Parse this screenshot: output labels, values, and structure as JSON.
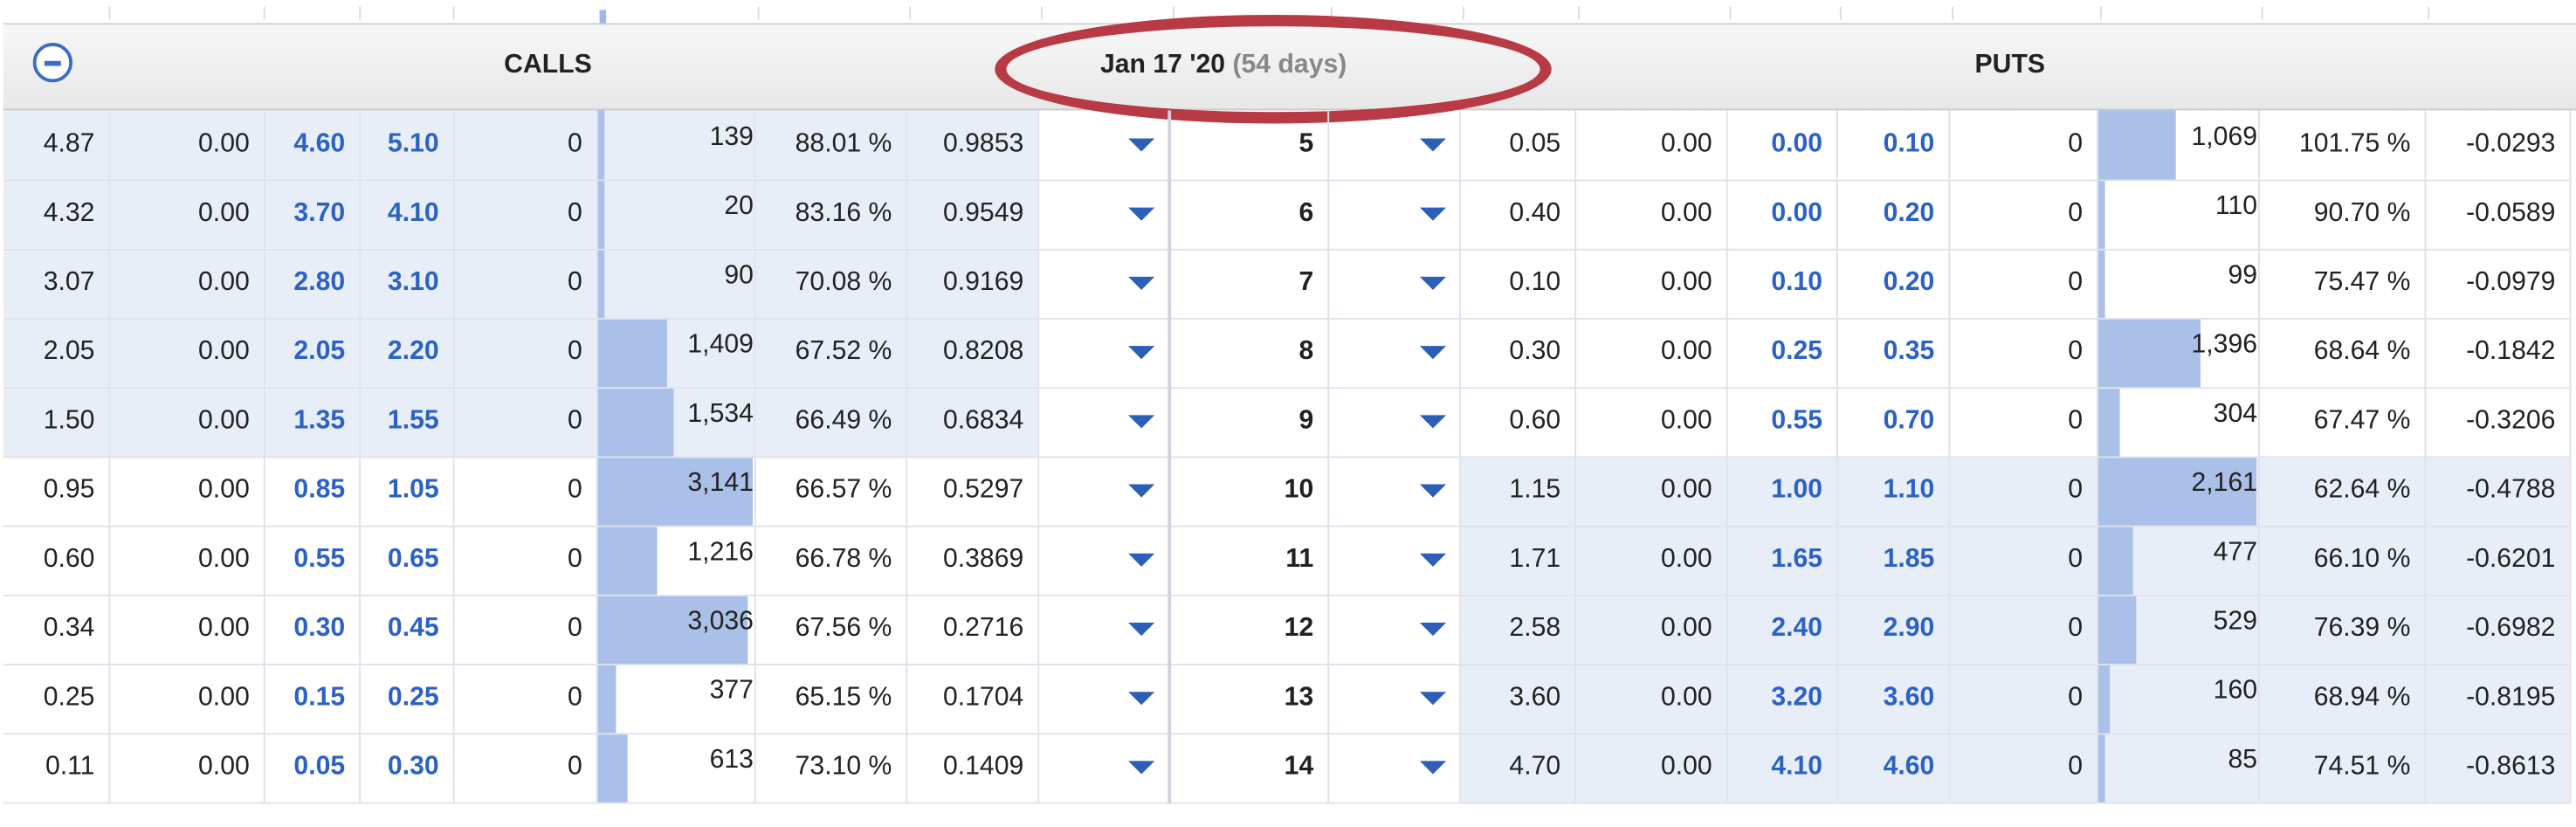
{
  "header": {
    "calls_label": "CALLS",
    "puts_label": "PUTS",
    "expiry": "Jan 17 '20",
    "days": "(54 days)",
    "collapse_icon": "minus-circle-icon"
  },
  "colors": {
    "itm_background": "#e8eef8",
    "bid_ask_text": "#2c62c4",
    "oi_bar": "#aac0e8",
    "highlight_ellipse": "#b83a45",
    "arrow": "#2c5fb8"
  },
  "rows": [
    {
      "call_last": "4.87",
      "call_change": "0.00",
      "call_bid": "4.60",
      "call_ask": "5.10",
      "call_volume": "0",
      "call_oi": "139",
      "call_oi_value": 139,
      "call_iv": "88.01 %",
      "call_delta": "0.9853",
      "strike": "5",
      "put_last": "0.05",
      "put_change": "0.00",
      "put_bid": "0.00",
      "put_ask": "0.10",
      "put_volume": "0",
      "put_oi": "1,069",
      "put_oi_value": 1069,
      "put_iv": "101.75 %",
      "put_delta": "-0.0293",
      "call_itm": true,
      "put_itm": false
    },
    {
      "call_last": "4.32",
      "call_change": "0.00",
      "call_bid": "3.70",
      "call_ask": "4.10",
      "call_volume": "0",
      "call_oi": "20",
      "call_oi_value": 20,
      "call_iv": "83.16 %",
      "call_delta": "0.9549",
      "strike": "6",
      "put_last": "0.40",
      "put_change": "0.00",
      "put_bid": "0.00",
      "put_ask": "0.20",
      "put_volume": "0",
      "put_oi": "110",
      "put_oi_value": 110,
      "put_iv": "90.70 %",
      "put_delta": "-0.0589",
      "call_itm": true,
      "put_itm": false
    },
    {
      "call_last": "3.07",
      "call_change": "0.00",
      "call_bid": "2.80",
      "call_ask": "3.10",
      "call_volume": "0",
      "call_oi": "90",
      "call_oi_value": 90,
      "call_iv": "70.08 %",
      "call_delta": "0.9169",
      "strike": "7",
      "put_last": "0.10",
      "put_change": "0.00",
      "put_bid": "0.10",
      "put_ask": "0.20",
      "put_volume": "0",
      "put_oi": "99",
      "put_oi_value": 99,
      "put_iv": "75.47 %",
      "put_delta": "-0.0979",
      "call_itm": true,
      "put_itm": false
    },
    {
      "call_last": "2.05",
      "call_change": "0.00",
      "call_bid": "2.05",
      "call_ask": "2.20",
      "call_volume": "0",
      "call_oi": "1,409",
      "call_oi_value": 1409,
      "call_iv": "67.52 %",
      "call_delta": "0.8208",
      "strike": "8",
      "put_last": "0.30",
      "put_change": "0.00",
      "put_bid": "0.25",
      "put_ask": "0.35",
      "put_volume": "0",
      "put_oi": "1,396",
      "put_oi_value": 1396,
      "put_iv": "68.64 %",
      "put_delta": "-0.1842",
      "call_itm": true,
      "put_itm": false
    },
    {
      "call_last": "1.50",
      "call_change": "0.00",
      "call_bid": "1.35",
      "call_ask": "1.55",
      "call_volume": "0",
      "call_oi": "1,534",
      "call_oi_value": 1534,
      "call_iv": "66.49 %",
      "call_delta": "0.6834",
      "strike": "9",
      "put_last": "0.60",
      "put_change": "0.00",
      "put_bid": "0.55",
      "put_ask": "0.70",
      "put_volume": "0",
      "put_oi": "304",
      "put_oi_value": 304,
      "put_iv": "67.47 %",
      "put_delta": "-0.3206",
      "call_itm": true,
      "put_itm": false
    },
    {
      "call_last": "0.95",
      "call_change": "0.00",
      "call_bid": "0.85",
      "call_ask": "1.05",
      "call_volume": "0",
      "call_oi": "3,141",
      "call_oi_value": 3141,
      "call_iv": "66.57 %",
      "call_delta": "0.5297",
      "strike": "10",
      "put_last": "1.15",
      "put_change": "0.00",
      "put_bid": "1.00",
      "put_ask": "1.10",
      "put_volume": "0",
      "put_oi": "2,161",
      "put_oi_value": 2161,
      "put_iv": "62.64 %",
      "put_delta": "-0.4788",
      "call_itm": false,
      "put_itm": true
    },
    {
      "call_last": "0.60",
      "call_change": "0.00",
      "call_bid": "0.55",
      "call_ask": "0.65",
      "call_volume": "0",
      "call_oi": "1,216",
      "call_oi_value": 1216,
      "call_iv": "66.78 %",
      "call_delta": "0.3869",
      "strike": "11",
      "put_last": "1.71",
      "put_change": "0.00",
      "put_bid": "1.65",
      "put_ask": "1.85",
      "put_volume": "0",
      "put_oi": "477",
      "put_oi_value": 477,
      "put_iv": "66.10 %",
      "put_delta": "-0.6201",
      "call_itm": false,
      "put_itm": true
    },
    {
      "call_last": "0.34",
      "call_change": "0.00",
      "call_bid": "0.30",
      "call_ask": "0.45",
      "call_volume": "0",
      "call_oi": "3,036",
      "call_oi_value": 3036,
      "call_iv": "67.56 %",
      "call_delta": "0.2716",
      "strike": "12",
      "put_last": "2.58",
      "put_change": "0.00",
      "put_bid": "2.40",
      "put_ask": "2.90",
      "put_volume": "0",
      "put_oi": "529",
      "put_oi_value": 529,
      "put_iv": "76.39 %",
      "put_delta": "-0.6982",
      "call_itm": false,
      "put_itm": true
    },
    {
      "call_last": "0.25",
      "call_change": "0.00",
      "call_bid": "0.15",
      "call_ask": "0.25",
      "call_volume": "0",
      "call_oi": "377",
      "call_oi_value": 377,
      "call_iv": "65.15 %",
      "call_delta": "0.1704",
      "strike": "13",
      "put_last": "3.60",
      "put_change": "0.00",
      "put_bid": "3.20",
      "put_ask": "3.60",
      "put_volume": "0",
      "put_oi": "160",
      "put_oi_value": 160,
      "put_iv": "68.94 %",
      "put_delta": "-0.8195",
      "call_itm": false,
      "put_itm": true
    },
    {
      "call_last": "0.11",
      "call_change": "0.00",
      "call_bid": "0.05",
      "call_ask": "0.30",
      "call_volume": "0",
      "call_oi": "613",
      "call_oi_value": 613,
      "call_iv": "73.10 %",
      "call_delta": "0.1409",
      "strike": "14",
      "put_last": "4.70",
      "put_change": "0.00",
      "put_bid": "4.10",
      "put_ask": "4.60",
      "put_volume": "0",
      "put_oi": "85",
      "put_oi_value": 85,
      "put_iv": "74.51 %",
      "put_delta": "-0.8613",
      "call_itm": false,
      "put_itm": true
    }
  ]
}
